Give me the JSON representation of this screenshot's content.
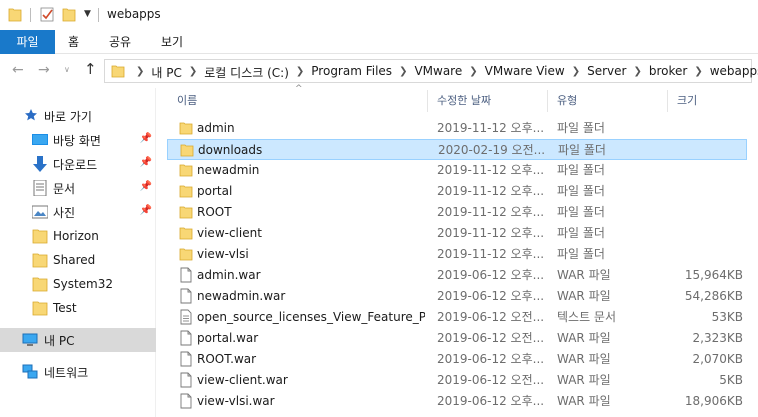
{
  "window": {
    "title": "webapps"
  },
  "ribbon": {
    "tabs": [
      "파일",
      "홈",
      "공유",
      "보기"
    ]
  },
  "address": {
    "crumbs": [
      "내 PC",
      "로컬 디스크 (C:)",
      "Program Files",
      "VMware",
      "VMware View",
      "Server",
      "broker",
      "webapps"
    ]
  },
  "sidebar": {
    "quick_access": "바로 가기",
    "items": [
      {
        "label": "바탕 화면",
        "icon": "desktop-icon",
        "pinned": true
      },
      {
        "label": "다운로드",
        "icon": "download-arrow-icon",
        "pinned": true
      },
      {
        "label": "문서",
        "icon": "document-icon",
        "pinned": true
      },
      {
        "label": "사진",
        "icon": "picture-icon",
        "pinned": true
      },
      {
        "label": "Horizon",
        "icon": "folder-icon",
        "pinned": false
      },
      {
        "label": "Shared",
        "icon": "folder-icon",
        "pinned": false
      },
      {
        "label": "System32",
        "icon": "folder-icon",
        "pinned": false
      },
      {
        "label": "Test",
        "icon": "folder-icon",
        "pinned": false
      }
    ],
    "this_pc": "내 PC",
    "network": "네트워크"
  },
  "columns": {
    "name": "이름",
    "date": "수정한 날짜",
    "type": "유형",
    "size": "크기"
  },
  "files": [
    {
      "name": "admin",
      "date": "2019-11-12 오후...",
      "type": "파일 폴더",
      "size": "",
      "kind": "folder"
    },
    {
      "name": "downloads",
      "date": "2020-02-19 오전...",
      "type": "파일 폴더",
      "size": "",
      "kind": "folder",
      "selected": true
    },
    {
      "name": "newadmin",
      "date": "2019-11-12 오후...",
      "type": "파일 폴더",
      "size": "",
      "kind": "folder"
    },
    {
      "name": "portal",
      "date": "2019-11-12 오후...",
      "type": "파일 폴더",
      "size": "",
      "kind": "folder"
    },
    {
      "name": "ROOT",
      "date": "2019-11-12 오후...",
      "type": "파일 폴더",
      "size": "",
      "kind": "folder"
    },
    {
      "name": "view-client",
      "date": "2019-11-12 오후...",
      "type": "파일 폴더",
      "size": "",
      "kind": "folder"
    },
    {
      "name": "view-vlsi",
      "date": "2019-11-12 오후...",
      "type": "파일 폴더",
      "size": "",
      "kind": "folder"
    },
    {
      "name": "admin.war",
      "date": "2019-06-12 오후...",
      "type": "WAR 파일",
      "size": "15,964KB",
      "kind": "file"
    },
    {
      "name": "newadmin.war",
      "date": "2019-06-12 오후...",
      "type": "WAR 파일",
      "size": "54,286KB",
      "kind": "file"
    },
    {
      "name": "open_source_licenses_View_Feature_Pac...",
      "date": "2019-06-12 오전...",
      "type": "텍스트 문서",
      "size": "53KB",
      "kind": "text"
    },
    {
      "name": "portal.war",
      "date": "2019-06-12 오전...",
      "type": "WAR 파일",
      "size": "2,323KB",
      "kind": "file"
    },
    {
      "name": "ROOT.war",
      "date": "2019-06-12 오후...",
      "type": "WAR 파일",
      "size": "2,070KB",
      "kind": "file"
    },
    {
      "name": "view-client.war",
      "date": "2019-06-12 오전...",
      "type": "WAR 파일",
      "size": "5KB",
      "kind": "file"
    },
    {
      "name": "view-vlsi.war",
      "date": "2019-06-12 오후...",
      "type": "WAR 파일",
      "size": "18,906KB",
      "kind": "file"
    }
  ],
  "colors": {
    "accent": "#1979ca",
    "folder": "#f8d775",
    "selection": "#cce8ff"
  }
}
